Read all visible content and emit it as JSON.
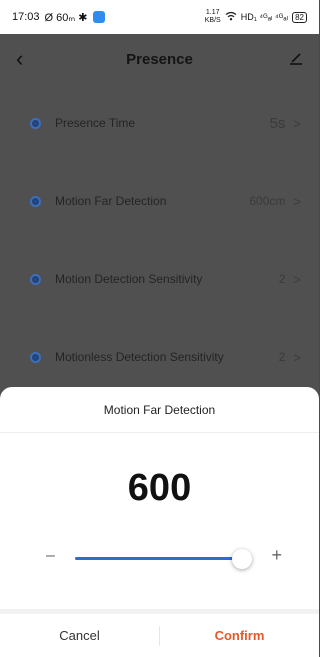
{
  "status_bar": {
    "time": "17:03",
    "left_icons_text": "Ø 60ₘ ✱",
    "net_speed": "1.17",
    "net_unit": "KB/S",
    "right_text": "HD₁ ⁴ᴳₐₗ ⁴ᴳₐₗ",
    "battery": "82"
  },
  "header": {
    "title": "Presence"
  },
  "rows": [
    {
      "label": "Presence Time",
      "value": "5s"
    },
    {
      "label": "Motion Far Detection",
      "value": "600cm"
    },
    {
      "label": "Motion Detection Sensitivity",
      "value": "2"
    },
    {
      "label": "Motionless Detection Sensitivity",
      "value": "2"
    }
  ],
  "sheet": {
    "title": "Motion Far Detection",
    "value": "600",
    "slider_fraction": 1.0,
    "minus": "–",
    "plus": "+",
    "cancel": "Cancel",
    "confirm": "Confirm"
  },
  "colors": {
    "accent": "#2c6bd8",
    "confirm": "#e35a2a",
    "overlay": "#505050"
  }
}
